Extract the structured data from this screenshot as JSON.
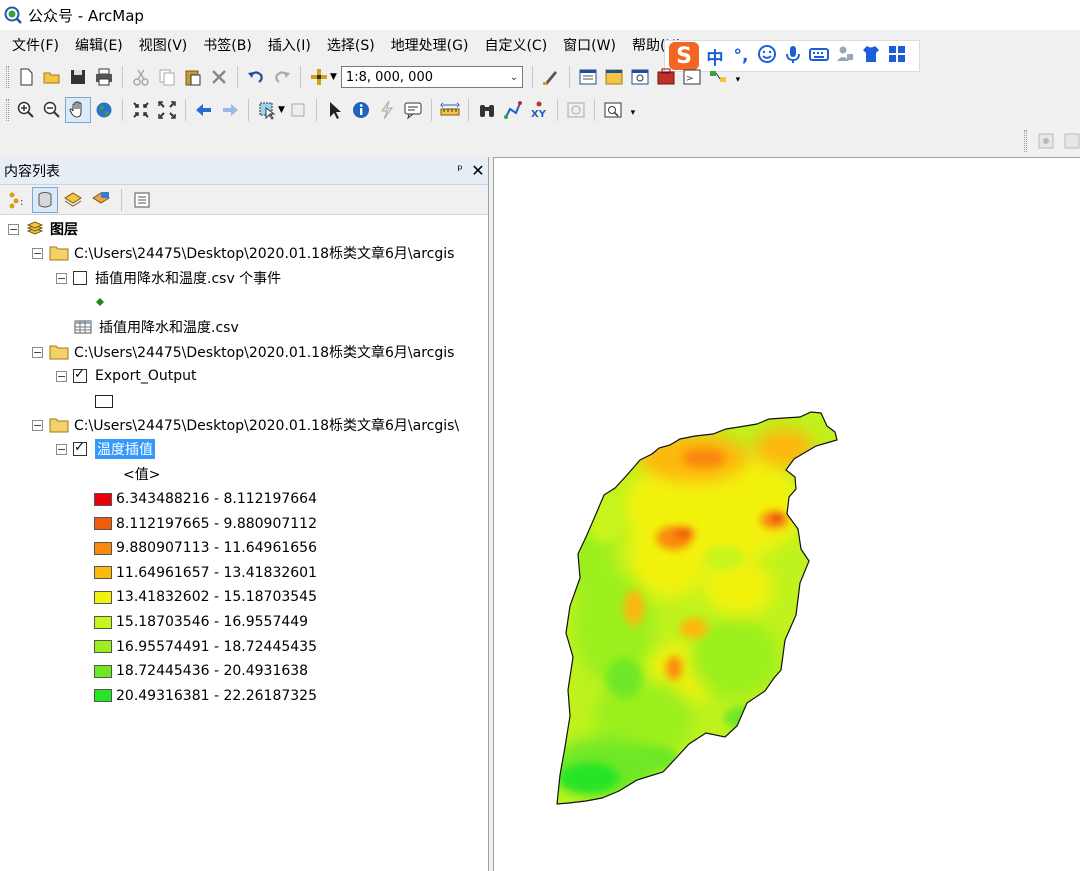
{
  "window": {
    "title": "公众号 - ArcMap"
  },
  "menu": [
    "文件(F)",
    "编辑(E)",
    "视图(V)",
    "书签(B)",
    "插入(I)",
    "选择(S)",
    "地理处理(G)",
    "自定义(C)",
    "窗口(W)",
    "帮助(H)"
  ],
  "toolbar": {
    "scale_value": "1:8, 000, 000"
  },
  "ime": {
    "items": [
      "中",
      "°,"
    ]
  },
  "toc": {
    "title": "内容列表",
    "pin_glyph": "ᵖ",
    "close_glyph": "✕",
    "root_label": "图层",
    "groups": [
      {
        "path": "C:\\Users\\24475\\Desktop\\2020.01.18栎类文章6月\\arcgis",
        "layers": [
          {
            "name": "插值用降水和温度.csv 个事件",
            "checked": false
          },
          {
            "name": "插值用降水和温度.csv",
            "type": "table"
          }
        ]
      },
      {
        "path": "C:\\Users\\24475\\Desktop\\2020.01.18栎类文章6月\\arcgis",
        "layers": [
          {
            "name": "Export_Output",
            "checked": true
          }
        ]
      },
      {
        "path": "C:\\Users\\24475\\Desktop\\2020.01.18栎类文章6月\\arcgis\\",
        "layers": [
          {
            "name": "温度插值",
            "checked": true,
            "selected": true
          }
        ]
      }
    ],
    "legend_heading": "<值>",
    "legend": [
      {
        "label": "6.343488216 - 8.112197664",
        "color": "#e8000b"
      },
      {
        "label": "8.112197665 - 9.880907112",
        "color": "#f25c0f"
      },
      {
        "label": "9.880907113 - 11.64961656",
        "color": "#fa8a0e"
      },
      {
        "label": "11.64961657 - 13.41832601",
        "color": "#fdb80e"
      },
      {
        "label": "13.41832602 - 15.18703545",
        "color": "#f2f20a"
      },
      {
        "label": "15.18703546 - 16.9557449",
        "color": "#c8f51c"
      },
      {
        "label": "16.95574491 - 18.72445435",
        "color": "#9bef1f"
      },
      {
        "label": "18.72445436 - 20.4931638",
        "color": "#6ee825"
      },
      {
        "label": "20.49316381 - 22.26187325",
        "color": "#28e428"
      }
    ]
  }
}
